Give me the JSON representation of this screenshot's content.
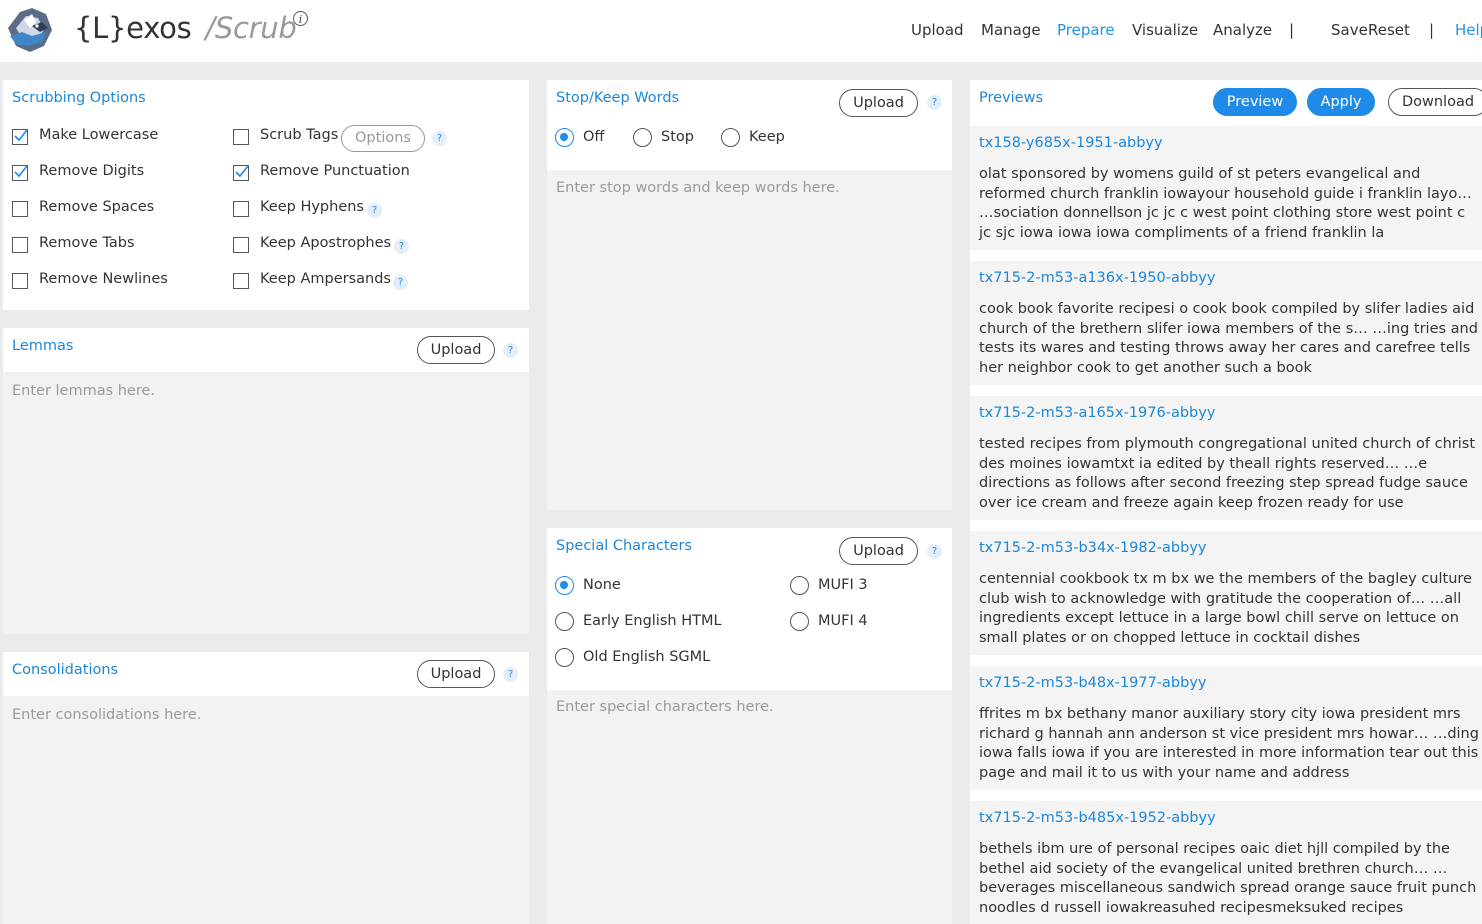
{
  "header": {
    "brand": "{L}exos",
    "tool": "/Scrub",
    "nav": [
      {
        "label": "Upload",
        "active": false
      },
      {
        "label": "Manage",
        "active": false
      },
      {
        "label": "Prepare",
        "active": true
      },
      {
        "label": "Visualize",
        "active": false
      },
      {
        "label": "Analyze",
        "active": false
      },
      {
        "label": "|",
        "active": false
      },
      {
        "label": "Save",
        "active": false
      },
      {
        "label": "Reset",
        "active": false
      },
      {
        "label": "|",
        "active": false
      },
      {
        "label": "Help",
        "active": true
      }
    ]
  },
  "help_glyph": "?",
  "scrubbing": {
    "title": "Scrubbing Options",
    "options_label": "Options",
    "left": [
      {
        "label": "Make Lowercase",
        "checked": true
      },
      {
        "label": "Remove Digits",
        "checked": true
      },
      {
        "label": "Remove Spaces",
        "checked": false
      },
      {
        "label": "Remove Tabs",
        "checked": false
      },
      {
        "label": "Remove Newlines",
        "checked": false
      }
    ],
    "right": [
      {
        "label": "Scrub Tags",
        "checked": false
      },
      {
        "label": "Remove Punctuation",
        "checked": true
      },
      {
        "label": "Keep Hyphens",
        "checked": false
      },
      {
        "label": "Keep Apostrophes",
        "checked": false
      },
      {
        "label": "Keep Ampersands",
        "checked": false
      }
    ]
  },
  "lemmas": {
    "title": "Lemmas",
    "upload": "Upload",
    "placeholder": "Enter lemmas here."
  },
  "consolidations": {
    "title": "Consolidations",
    "upload": "Upload",
    "placeholder": "Enter consolidations here."
  },
  "stopwords": {
    "title": "Stop/Keep Words",
    "upload": "Upload",
    "radios": [
      {
        "label": "Off",
        "selected": true
      },
      {
        "label": "Stop",
        "selected": false
      },
      {
        "label": "Keep",
        "selected": false
      }
    ],
    "placeholder": "Enter stop words and keep words here."
  },
  "special": {
    "title": "Special Characters",
    "upload": "Upload",
    "radios": [
      {
        "label": "None",
        "selected": true
      },
      {
        "label": "Early English HTML",
        "selected": false
      },
      {
        "label": "Old English SGML",
        "selected": false
      },
      {
        "label": "MUFI 3",
        "selected": false
      },
      {
        "label": "MUFI 4",
        "selected": false
      }
    ],
    "placeholder": "Enter special characters here."
  },
  "previews": {
    "title": "Previews",
    "buttons": {
      "preview": "Preview",
      "apply": "Apply",
      "download": "Download"
    },
    "items": [
      {
        "name": "tx158-y685x-1951-abbyy",
        "text": "olat sponsored by womens guild of st peters evangelical and reformed church franklin iowayour household guide i franklin layo… …sociation donnellson jc jc c west point clothing store west point c jc sjc iowa iowa iowa compliments of a friend franklin la"
      },
      {
        "name": "tx715-2-m53-a136x-1950-abbyy",
        "text": "cook book favorite recipesi o  cook book compiled by slifer ladies aid church of the brethern slifer iowa members of the s… …ing tries and tests its wares and testing throws away her cares and carefree tells her neighbor cook to get another such a book"
      },
      {
        "name": "tx715-2-m53-a165x-1976-abbyy",
        "text": "tested recipes from plymouth congregational united church of christ des moines iowamtxt ia edited by theall rights reserved… …e directions as follows after second freezing step spread fudge sauce over ice cream and freeze again keep frozen ready for use"
      },
      {
        "name": "tx715-2-m53-b34x-1982-abbyy",
        "text": "centennial cookbook tx m bx we the members of the bagley culture club wish to acknowledge with gratitude the cooperation of… …all ingredients except lettuce in a large bowl chill serve on lettuce on small plates or on chopped lettuce in cocktail dishes"
      },
      {
        "name": "tx715-2-m53-b48x-1977-abbyy",
        "text": "ffrites m bx  bethany manor auxiliary story city iowa president mrs richard g hannah ann anderson st vice president mrs howar… …ding iowa falls iowa if you are interested in more information tear out this page and mail it to us with your name and address"
      },
      {
        "name": "tx715-2-m53-b485x-1952-abbyy",
        "text": "bethels ibm ure of personal recipes oaic diet hjll compiled by the bethel aid society of the evangelical united brethren church… … beverages miscellaneous sandwich spread orange sauce fruit punch noodles d russell iowakreasuhed recipesmeksuked recipes"
      }
    ]
  }
}
